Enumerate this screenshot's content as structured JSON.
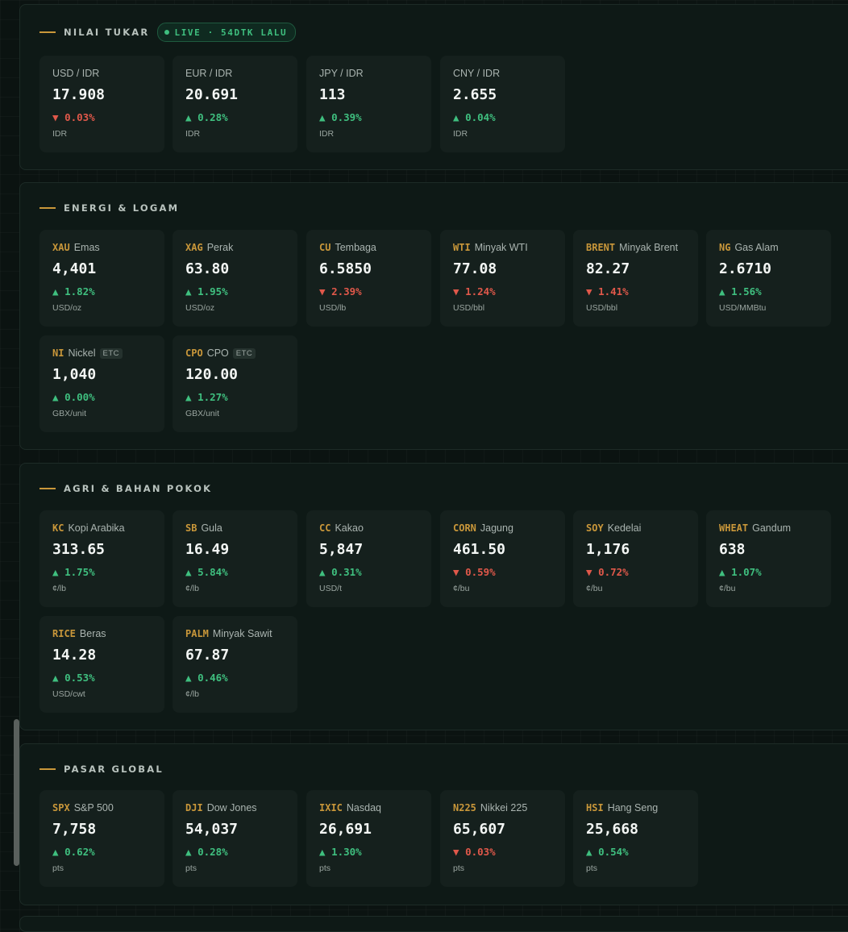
{
  "sections": {
    "fx": {
      "title": "NILAI TUKAR",
      "live_label": "LIVE · 54DTK LALU",
      "cards": [
        {
          "pair": "USD / IDR",
          "value": "17.908",
          "change": "0.03%",
          "dir": "down",
          "arrow": "▼",
          "unit": "IDR"
        },
        {
          "pair": "EUR / IDR",
          "value": "20.691",
          "change": "0.28%",
          "dir": "up",
          "arrow": "▲",
          "unit": "IDR"
        },
        {
          "pair": "JPY / IDR",
          "value": "113",
          "change": "0.39%",
          "dir": "up",
          "arrow": "▲",
          "unit": "IDR"
        },
        {
          "pair": "CNY / IDR",
          "value": "2.655",
          "change": "0.04%",
          "dir": "up",
          "arrow": "▲",
          "unit": "IDR"
        }
      ]
    },
    "energy": {
      "title": "ENERGI & LOGAM",
      "cards": [
        {
          "sym": "XAU",
          "name": "Emas",
          "value": "4,401",
          "change": "1.82%",
          "dir": "up",
          "arrow": "▲",
          "unit": "USD/oz"
        },
        {
          "sym": "XAG",
          "name": "Perak",
          "value": "63.80",
          "change": "1.95%",
          "dir": "up",
          "arrow": "▲",
          "unit": "USD/oz"
        },
        {
          "sym": "CU",
          "name": "Tembaga",
          "value": "6.5850",
          "change": "2.39%",
          "dir": "down",
          "arrow": "▼",
          "unit": "USD/lb"
        },
        {
          "sym": "WTI",
          "name": "Minyak WTI",
          "value": "77.08",
          "change": "1.24%",
          "dir": "down",
          "arrow": "▼",
          "unit": "USD/bbl"
        },
        {
          "sym": "BRENT",
          "name": "Minyak Brent",
          "value": "82.27",
          "change": "1.41%",
          "dir": "down",
          "arrow": "▼",
          "unit": "USD/bbl"
        },
        {
          "sym": "NG",
          "name": "Gas Alam",
          "value": "2.6710",
          "change": "1.56%",
          "dir": "up",
          "arrow": "▲",
          "unit": "USD/MMBtu"
        },
        {
          "sym": "NI",
          "name": "Nickel",
          "tag": "ETC",
          "value": "1,040",
          "change": "0.00%",
          "dir": "up",
          "arrow": "▲",
          "unit": "GBX/unit"
        },
        {
          "sym": "CPO",
          "name": "CPO",
          "tag": "ETC",
          "value": "120.00",
          "change": "1.27%",
          "dir": "up",
          "arrow": "▲",
          "unit": "GBX/unit"
        }
      ]
    },
    "agri": {
      "title": "AGRI & BAHAN POKOK",
      "cards": [
        {
          "sym": "KC",
          "name": "Kopi Arabika",
          "value": "313.65",
          "change": "1.75%",
          "dir": "up",
          "arrow": "▲",
          "unit": "¢/lb"
        },
        {
          "sym": "SB",
          "name": "Gula",
          "value": "16.49",
          "change": "5.84%",
          "dir": "up",
          "arrow": "▲",
          "unit": "¢/lb"
        },
        {
          "sym": "CC",
          "name": "Kakao",
          "value": "5,847",
          "change": "0.31%",
          "dir": "up",
          "arrow": "▲",
          "unit": "USD/t"
        },
        {
          "sym": "CORN",
          "name": "Jagung",
          "value": "461.50",
          "change": "0.59%",
          "dir": "down",
          "arrow": "▼",
          "unit": "¢/bu"
        },
        {
          "sym": "SOY",
          "name": "Kedelai",
          "value": "1,176",
          "change": "0.72%",
          "dir": "down",
          "arrow": "▼",
          "unit": "¢/bu"
        },
        {
          "sym": "WHEAT",
          "name": "Gandum",
          "value": "638",
          "change": "1.07%",
          "dir": "up",
          "arrow": "▲",
          "unit": "¢/bu"
        },
        {
          "sym": "RICE",
          "name": "Beras",
          "value": "14.28",
          "change": "0.53%",
          "dir": "up",
          "arrow": "▲",
          "unit": "USD/cwt"
        },
        {
          "sym": "PALM",
          "name": "Minyak Sawit",
          "value": "67.87",
          "change": "0.46%",
          "dir": "up",
          "arrow": "▲",
          "unit": "¢/lb"
        }
      ]
    },
    "global": {
      "title": "PASAR GLOBAL",
      "cards": [
        {
          "sym": "SPX",
          "name": "S&P 500",
          "value": "7,758",
          "change": "0.62%",
          "dir": "up",
          "arrow": "▲",
          "unit": "pts"
        },
        {
          "sym": "DJI",
          "name": "Dow Jones",
          "value": "54,037",
          "change": "0.28%",
          "dir": "up",
          "arrow": "▲",
          "unit": "pts"
        },
        {
          "sym": "IXIC",
          "name": "Nasdaq",
          "value": "26,691",
          "change": "1.30%",
          "dir": "up",
          "arrow": "▲",
          "unit": "pts"
        },
        {
          "sym": "N225",
          "name": "Nikkei 225",
          "value": "65,607",
          "change": "0.03%",
          "dir": "down",
          "arrow": "▼",
          "unit": "pts"
        },
        {
          "sym": "HSI",
          "name": "Hang Seng",
          "value": "25,668",
          "change": "0.54%",
          "dir": "up",
          "arrow": "▲",
          "unit": "pts"
        }
      ]
    }
  }
}
